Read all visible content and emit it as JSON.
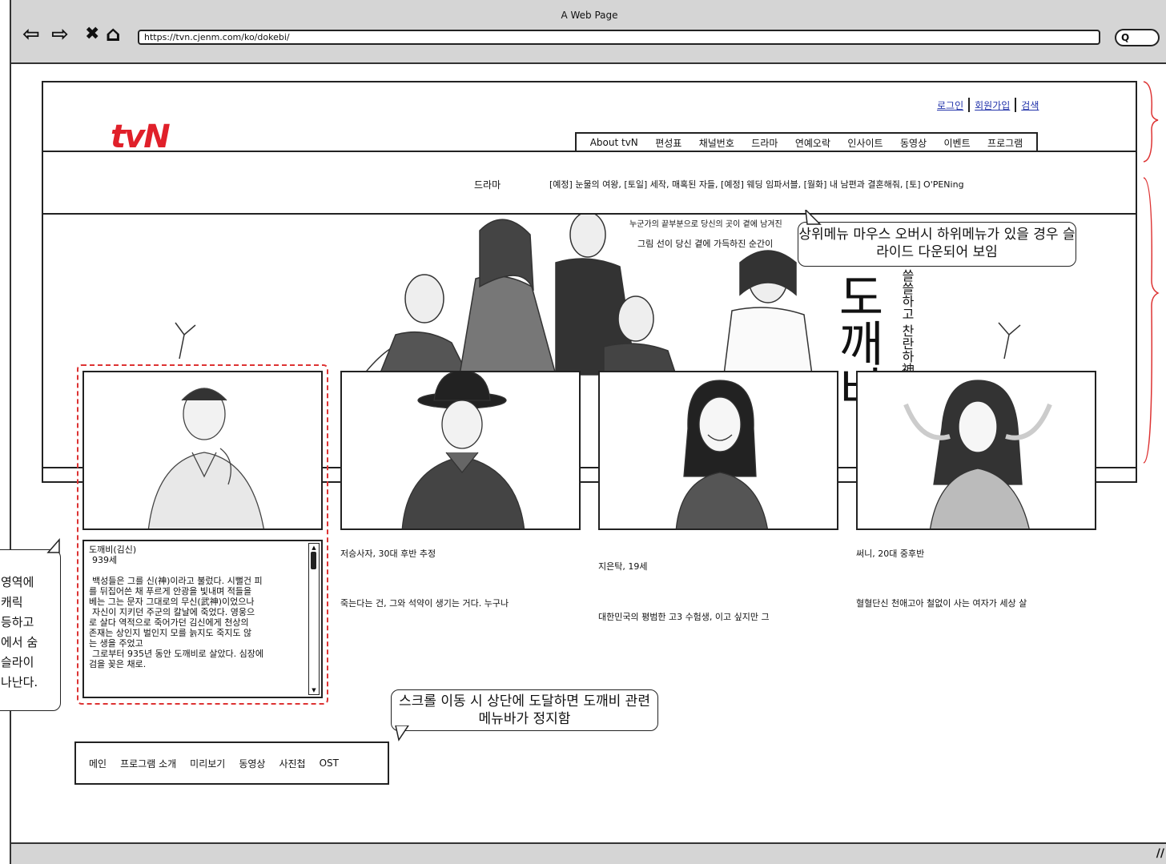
{
  "browser": {
    "title": "A Web Page",
    "url": "https://tvn.cjenm.com/ko/dokebi/",
    "search_glyph": "Q"
  },
  "site": {
    "logo": "tvN",
    "top_links": [
      "로그인",
      "회원가입",
      "검색"
    ],
    "gnb": [
      "About tvN",
      "편성표",
      "채널번호",
      "드라마",
      "연예오락",
      "인사이트",
      "동영상",
      "이벤트",
      "프로그램"
    ],
    "submenu_category": "드라마",
    "submenu_items": "[예정] 눈물의 여왕, [토일] 세작, 매혹된 자들, [예정] 웨딩 임파서블, [월화] 내 남편과 결혼해줘, [토] O'PENing"
  },
  "hero": {
    "tagline_1": "누군가의 끝부분으로 당신의 곳이 곁에 남겨진",
    "tagline_2": "그림 선이 당신 곁에 가득하진 순간이",
    "title_art": "도깨비",
    "sub_art": "쓸쓸하고 찬란하神"
  },
  "callouts": {
    "hover_menu": "상위메뉴 마우스 오버시 하위메뉴가 있을 경우 슬라이드 다운되어 보임",
    "sticky_menu": "스크롤 이동 시 상단에 도달하면 도깨비 관련 메뉴바가 정지함",
    "left_note": "영역에\n캐릭\n등하고\n에서 숨\n슬라이\n나난다."
  },
  "characters": [
    {
      "name": "도깨비(김신)",
      "age": "939세",
      "bio": [
        "백성들은 그를 신(神)이라고 불렀다. 시뻘건 피",
        "를 뒤집어쓴 채 푸르게 안광을 빛내며 적들을",
        "베는 그는 문자 그대로의 무신(武神)이었으나",
        "자신이 지키던 주군의 칼날에 죽었다. 영웅으",
        "로 살다 역적으로 죽어가던 김신에게 천상의",
        "존재는 상인지 벌인지 모를 늙지도 죽지도 않",
        "는 생을 주었고",
        "그로부터 935년 동안 도깨비로 살았다. 심장에",
        "검을 꽂은 채로."
      ]
    },
    {
      "caption": "저승사자, 30대 후반 추정",
      "desc": "죽는다는 건, 그와 석약이 생기는 거다. 누구나"
    },
    {
      "caption": "지은탁, 19세",
      "desc": "대한민국의 평범한 고3 수험생, 이고 싶지만 그"
    },
    {
      "caption": "써니, 20대 중후반",
      "desc": "혈혈단신 천애고아 철없이 사는 여자가 세상 살"
    }
  ],
  "dokebi_menu": [
    "메인",
    "프로그램 소개",
    "미리보기",
    "동영상",
    "사진첩",
    "OST"
  ],
  "colors": {
    "logo": "#e0202a",
    "selection": "#dd3333",
    "link": "#2233aa",
    "chrome": "#d5d5d5"
  }
}
